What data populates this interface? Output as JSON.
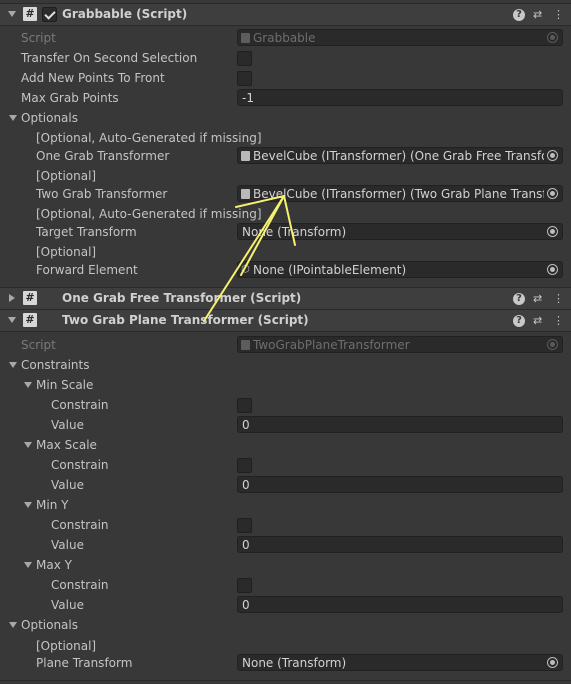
{
  "grabbable": {
    "title": "Grabbable (Script)",
    "script_label": "Script",
    "script_value": "Grabbable",
    "transfer_label": "Transfer On Second Selection",
    "add_points_label": "Add New Points To Front",
    "max_grab_label": "Max Grab Points",
    "max_grab_value": "-1",
    "optionals_label": "Optionals",
    "one_grab_hint": "[Optional, Auto-Generated if missing]",
    "one_grab_label": "One Grab Transformer",
    "one_grab_value": "BevelCube (ITransformer) (One Grab Free Transform",
    "two_grab_hint": "[Optional]",
    "two_grab_label": "Two Grab Transformer",
    "two_grab_value": "BevelCube (ITransformer) (Two Grab Plane Transfor",
    "target_hint": "[Optional, Auto-Generated if missing]",
    "target_label": "Target Transform",
    "target_value": "None (Transform)",
    "forward_hint": "[Optional]",
    "forward_label": "Forward Element",
    "forward_value": "None (IPointableElement)"
  },
  "one_grab_free": {
    "title": "One Grab Free Transformer (Script)"
  },
  "two_grab_plane": {
    "title": "Two Grab Plane Transformer (Script)",
    "script_label": "Script",
    "script_value": "TwoGrabPlaneTransformer",
    "constraints_label": "Constraints",
    "min_scale_label": "Min Scale",
    "max_scale_label": "Max Scale",
    "min_y_label": "Min Y",
    "max_y_label": "Max Y",
    "constrain_label": "Constrain",
    "value_label": "Value",
    "min_scale_value": "0",
    "max_scale_value": "0",
    "min_y_value": "0",
    "max_y_value": "0",
    "optionals_label": "Optionals",
    "plane_hint": "[Optional]",
    "plane_label": "Plane Transform",
    "plane_value": "None (Transform)"
  },
  "icons": {
    "header_help": "?",
    "header_preset": "⇄",
    "header_menu": "⋮",
    "script": "#"
  },
  "colors": {
    "background": "#383838",
    "header": "#3e3e3e",
    "field": "#2a2a2a",
    "annotation": "#f5f070"
  }
}
